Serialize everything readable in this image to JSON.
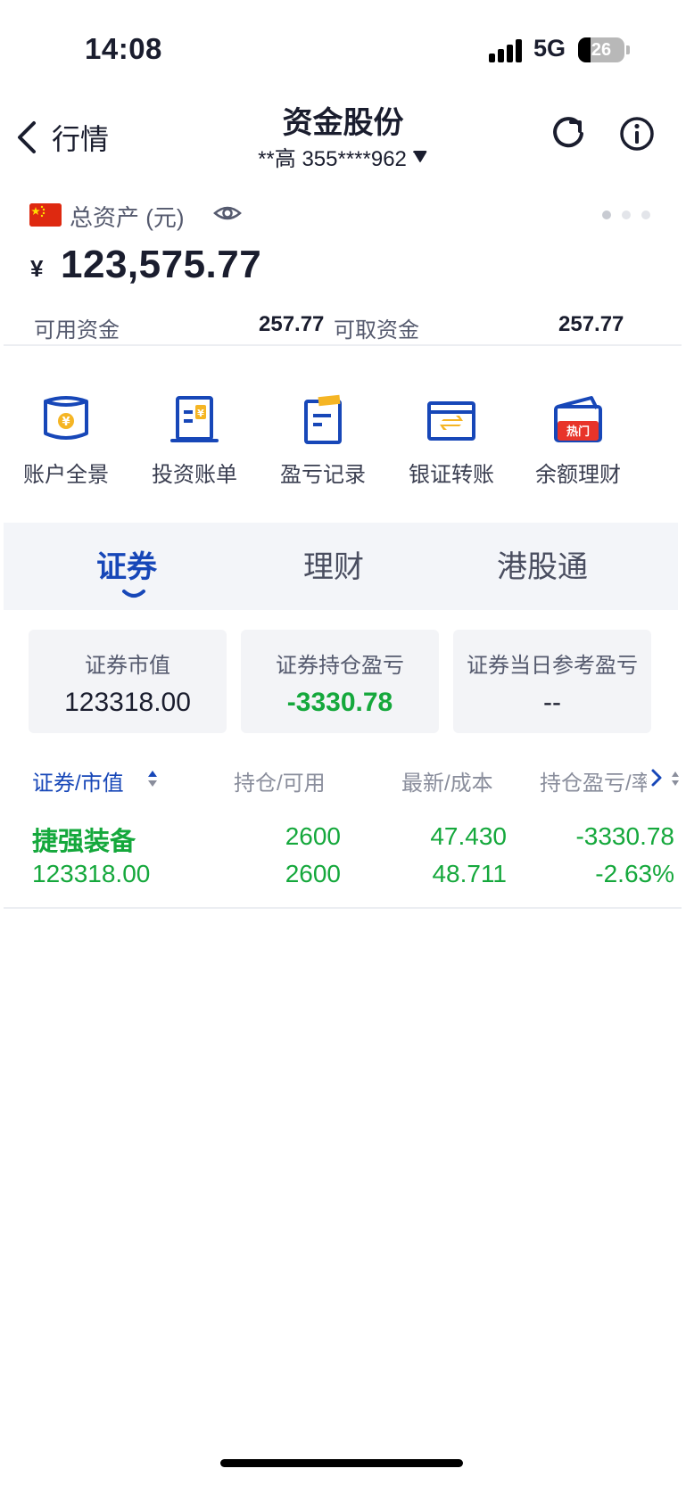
{
  "status_bar": {
    "time": "14:08",
    "network": "5G",
    "battery_level": "26",
    "battery_fraction": 0.26
  },
  "nav": {
    "back_label": "行情",
    "title": "资金股份",
    "account": "**高 355****962",
    "refresh_icon": "refresh-icon",
    "info_icon": "info-icon"
  },
  "asset": {
    "label": "总资产 (元)",
    "currency": "¥",
    "total": "123,575.77",
    "available_label": "可用资金",
    "available_value": "257.77",
    "withdrawable_label": "可取资金",
    "withdrawable_value": "257.77",
    "page_count": 3,
    "page_active": 1
  },
  "shortcuts": [
    {
      "label": "账户全景",
      "icon": "account-overview-icon"
    },
    {
      "label": "投资账单",
      "icon": "investment-bill-icon"
    },
    {
      "label": "盈亏记录",
      "icon": "pnl-record-icon"
    },
    {
      "label": "银证转账",
      "icon": "bank-transfer-icon"
    },
    {
      "label": "余额理财",
      "icon": "balance-finance-icon",
      "badge": "热门"
    }
  ],
  "tabs": [
    {
      "label": "证券",
      "active": true
    },
    {
      "label": "理财",
      "active": false
    },
    {
      "label": "港股通",
      "active": false
    }
  ],
  "cards": [
    {
      "label": "证券市值",
      "value": "123318.00"
    },
    {
      "label": "证券持仓盈亏",
      "value": "-3330.78"
    },
    {
      "label": "证券当日参考盈亏",
      "value": "--"
    }
  ],
  "table": {
    "columns": [
      "证券/市值",
      "持仓/可用",
      "最新/成本",
      "持仓盈亏/率"
    ],
    "rows": [
      {
        "name": "捷强装备",
        "market_value": "123318.00",
        "position": "2600",
        "available": "2600",
        "latest": "47.430",
        "cost": "48.711",
        "pnl": "-3330.78",
        "pnl_rate": "-2.63%"
      }
    ]
  },
  "colors": {
    "accent": "#1747b8",
    "loss_green": "#15a83c",
    "text": "#1a1d2e",
    "tab_bg": "#f3f5f9"
  }
}
